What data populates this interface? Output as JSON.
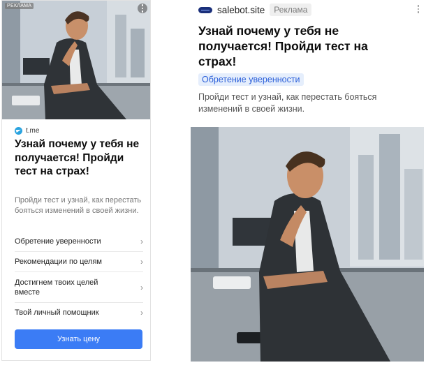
{
  "left_card": {
    "ad_badge": "РЕКЛАМА",
    "source": "t.me",
    "title": "Узнай почему у тебя не получается! Пройди тест на страх!",
    "description": "Пройди тест и узнай, как перестать бояться изменений в своей жизни.",
    "menu": [
      {
        "label": "Обретение уверенности"
      },
      {
        "label": "Рекомендации по целям"
      },
      {
        "label": "Достигнем твоих целей вместе"
      },
      {
        "label": "Твой личный помощник"
      }
    ],
    "cta_label": "Узнать цену",
    "cta_color": "#3b7cf5"
  },
  "right_card": {
    "site": "salebot.site",
    "ad_badge": "Реклама",
    "title": "Узнай почему у тебя не получается! Пройди тест на страх!",
    "tag": "Обретение уверенности",
    "description": "Пройди тест и узнай, как перестать бояться изменений в своей жизни."
  },
  "icons": {
    "source_icon": "telegram-icon",
    "menu_arrow": "chevron-right-icon",
    "more": "more-vertical-icon",
    "brand": "salebot-logo-icon"
  }
}
